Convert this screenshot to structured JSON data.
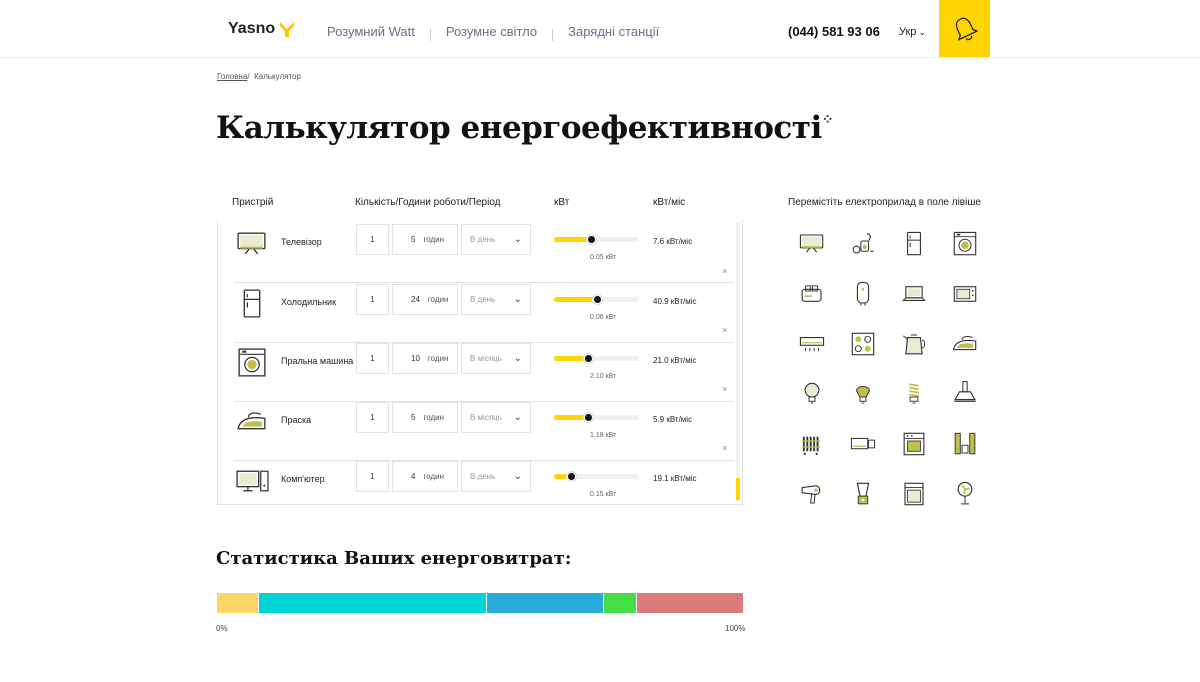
{
  "header": {
    "logo": "Yasno",
    "nav": [
      "Розумний Watt",
      "Розумне світло",
      "Зарядні станції"
    ],
    "phone": "(044) 581 93 06",
    "lang": "Укр",
    "accent": "#ffd400"
  },
  "breadcrumb": {
    "home": "Головна",
    "sep": "/",
    "current": "Калькулятор"
  },
  "title": "Калькулятор енергоефективності",
  "table": {
    "headers": {
      "device": "Пристрій",
      "qty": "Кількість/Години роботи/Період",
      "kw": "кВт",
      "month": "кВт/міс"
    },
    "hint": "Перемістіть електроприлад в поле лівіше",
    "rows": [
      {
        "icon": "tv-icon",
        "name": "Телевізор",
        "qty": "1",
        "hours": "5",
        "hours_unit": "годин",
        "period": "В день",
        "fill": 0.43,
        "kw": "0.05 кВт",
        "month": "7.6 кВт/міс"
      },
      {
        "icon": "fridge-icon",
        "name": "Холодильник",
        "qty": "1",
        "hours": "24",
        "hours_unit": "годин",
        "period": "В день",
        "fill": 0.5,
        "kw": "0.06 кВт",
        "month": "40.9 кВт/міс"
      },
      {
        "icon": "washing-machine-icon",
        "name": "Пральна машина",
        "qty": "1",
        "hours": "10",
        "hours_unit": "годин",
        "period": "В місяць",
        "fill": 0.4,
        "kw": "2.10 кВт",
        "month": "21.0 кВт/міс"
      },
      {
        "icon": "iron-icon",
        "name": "Праска",
        "qty": "1",
        "hours": "5",
        "hours_unit": "годин",
        "period": "В місяць",
        "fill": 0.4,
        "kw": "1.18 кВт",
        "month": "5.9 кВт/міс"
      },
      {
        "icon": "computer-icon",
        "name": "Комп'ютер",
        "qty": "1",
        "hours": "4",
        "hours_unit": "годин",
        "period": "В день",
        "fill": 0.2,
        "kw": "0.15 кВт",
        "month": "19.1 кВт/міс"
      }
    ],
    "close": "×"
  },
  "palette": [
    "tv-icon",
    "vacuum-icon",
    "fridge-icon",
    "washing-machine-icon",
    "toaster-icon",
    "boiler-icon",
    "laptop-icon",
    "microwave-icon",
    "air-conditioner-icon",
    "stove-icon",
    "kettle-icon",
    "iron-icon",
    "bulb-icon",
    "led-bulb-icon",
    "cfl-bulb-icon",
    "hood-icon",
    "heater-icon",
    "split-ac-icon",
    "oven-icon",
    "speakers-icon",
    "hair-dryer-icon",
    "blender-icon",
    "dishwasher-icon",
    "fan-icon"
  ],
  "stats": {
    "title": "Статистика Ваших енерговитрат:",
    "segments": [
      {
        "value": 7.6,
        "color": "#ffd766"
      },
      {
        "value": 40.9,
        "color": "#00d4d4"
      },
      {
        "value": 21.0,
        "color": "#29acdc"
      },
      {
        "value": 5.9,
        "color": "#44dd44"
      },
      {
        "value": 19.1,
        "color": "#db7b7b"
      }
    ],
    "min_label": "0%",
    "max_label": "100%"
  }
}
